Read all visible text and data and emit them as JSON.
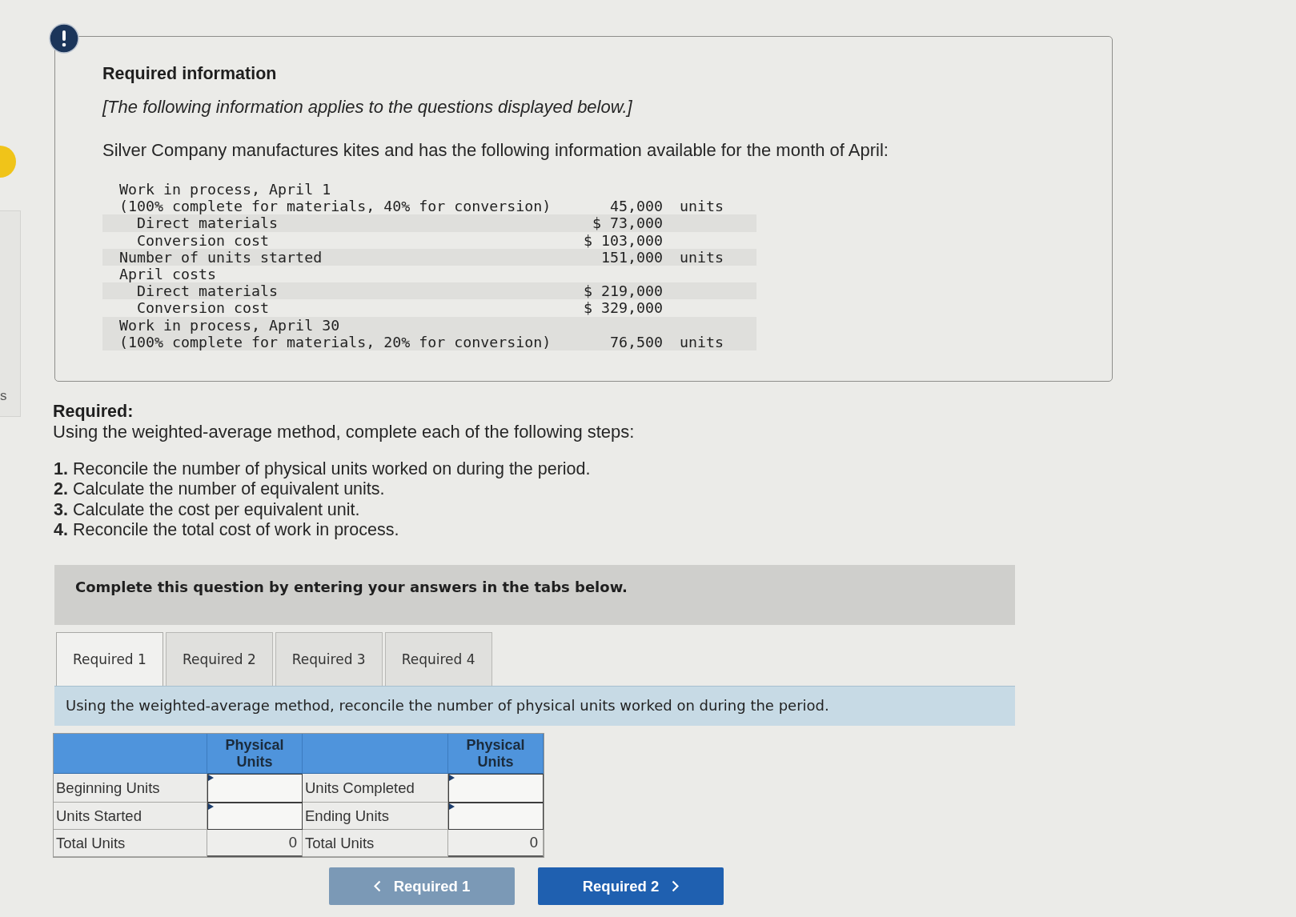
{
  "side_panel": {
    "text": "s"
  },
  "info_box": {
    "title": "Required information",
    "note": "[The following information applies to the questions displayed below.]",
    "intro": "Silver Company manufactures kites and has the following information available for the month of April:",
    "data": [
      {
        "label": "Work in process, April 1",
        "detail": "(100% complete for materials, 40% for conversion)",
        "amount": "45,000",
        "unit": "units",
        "children": [
          {
            "label": "Direct materials",
            "amount": "$ 73,000"
          },
          {
            "label": "Conversion cost",
            "amount": "$ 103,000"
          }
        ]
      },
      {
        "label": "Number of units started",
        "amount": "151,000",
        "unit": "units"
      },
      {
        "label": "April costs",
        "children": [
          {
            "label": "Direct materials",
            "amount": "$ 219,000"
          },
          {
            "label": "Conversion cost",
            "amount": "$ 329,000"
          }
        ]
      },
      {
        "label": "Work in process, April 30",
        "detail": "(100% complete for materials, 20% for conversion)",
        "amount": "76,500",
        "unit": "units"
      }
    ]
  },
  "required": {
    "heading": "Required:",
    "instruction": "Using the weighted-average method, complete each of the following steps:",
    "steps": [
      "**1.** Reconcile the number of physical units worked on during the period.",
      "**2.** Calculate the number of equivalent units.",
      "**3.** Calculate the cost per equivalent unit.",
      "**4.** Reconcile the total cost of work in process."
    ]
  },
  "banner": {
    "text": "Complete this question by entering your answers in the tabs below."
  },
  "tabs": [
    {
      "label": "Required 1",
      "selected": true
    },
    {
      "label": "Required 2",
      "selected": false
    },
    {
      "label": "Required 3",
      "selected": false
    },
    {
      "label": "Required 4",
      "selected": false
    }
  ],
  "tab_panel": {
    "instruction": "Using the weighted-average method, reconcile the number of physical units worked on during the period.",
    "table": {
      "sections": [
        {
          "heading": "Physical Units",
          "rows": [
            {
              "label": "Beginning Units",
              "kind": "input"
            },
            {
              "label": "Units Started",
              "kind": "input"
            },
            {
              "label": "Total Units",
              "kind": "total",
              "value": "0"
            }
          ]
        },
        {
          "heading": "Physical Units",
          "rows": [
            {
              "label": "Units Completed",
              "kind": "input"
            },
            {
              "label": "Ending Units",
              "kind": "input"
            },
            {
              "label": "Total Units",
              "kind": "total",
              "value": "0"
            }
          ]
        }
      ]
    },
    "nav_buttons": [
      {
        "kind": "previous",
        "label": "Required 1",
        "disabled": true
      },
      {
        "kind": "next",
        "label": "Required 2",
        "disabled": false
      }
    ]
  }
}
